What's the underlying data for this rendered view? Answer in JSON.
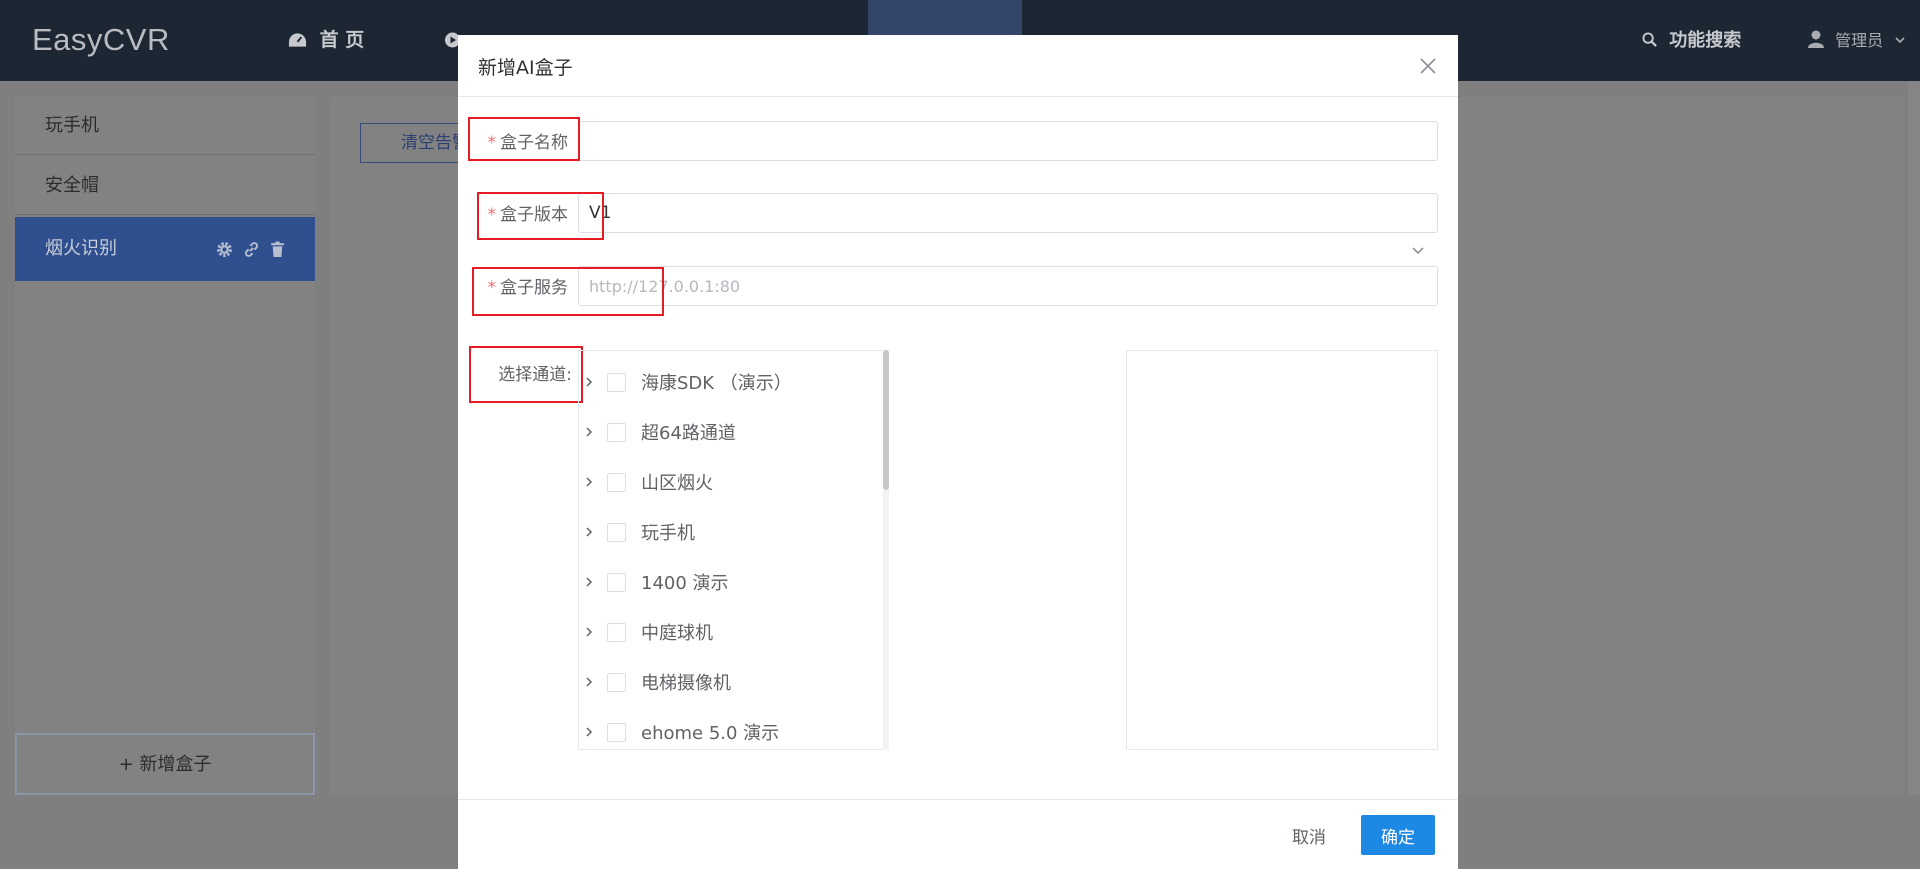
{
  "app": {
    "brand": "EasyCVR",
    "nav": [
      "首 页",
      "",
      "",
      "",
      "",
      "",
      "",
      ""
    ],
    "search": "功能搜索",
    "user": "管理员"
  },
  "sidebar": {
    "items": [
      {
        "label": "玩手机"
      },
      {
        "label": "安全帽"
      },
      {
        "label": "烟火识别"
      }
    ],
    "add_label": "+ 新增盒子"
  },
  "main": {
    "clear_button": "清空告警"
  },
  "modal": {
    "title": "新增AI盒子",
    "fields": {
      "name": {
        "label": "盒子名称",
        "value": ""
      },
      "version": {
        "label": "盒子版本",
        "value": "V1"
      },
      "service": {
        "label": "盒子服务",
        "placeholder": "http://127.0.0.1:80"
      },
      "channels": {
        "label": "选择通道:"
      }
    },
    "tree": [
      {
        "label": "海康SDK （演示）"
      },
      {
        "label": "超64路通道"
      },
      {
        "label": "山区烟火"
      },
      {
        "label": "玩手机"
      },
      {
        "label": "1400 演示"
      },
      {
        "label": "中庭球机"
      },
      {
        "label": "电梯摄像机"
      },
      {
        "label": "ehome 5.0 演示"
      }
    ],
    "cancel": "取消",
    "confirm": "确定"
  },
  "colors": {
    "primary": "#1e88e5",
    "required": "#f56c6c",
    "highlight": "#e51c23",
    "nav_bg": "#1d2633"
  }
}
